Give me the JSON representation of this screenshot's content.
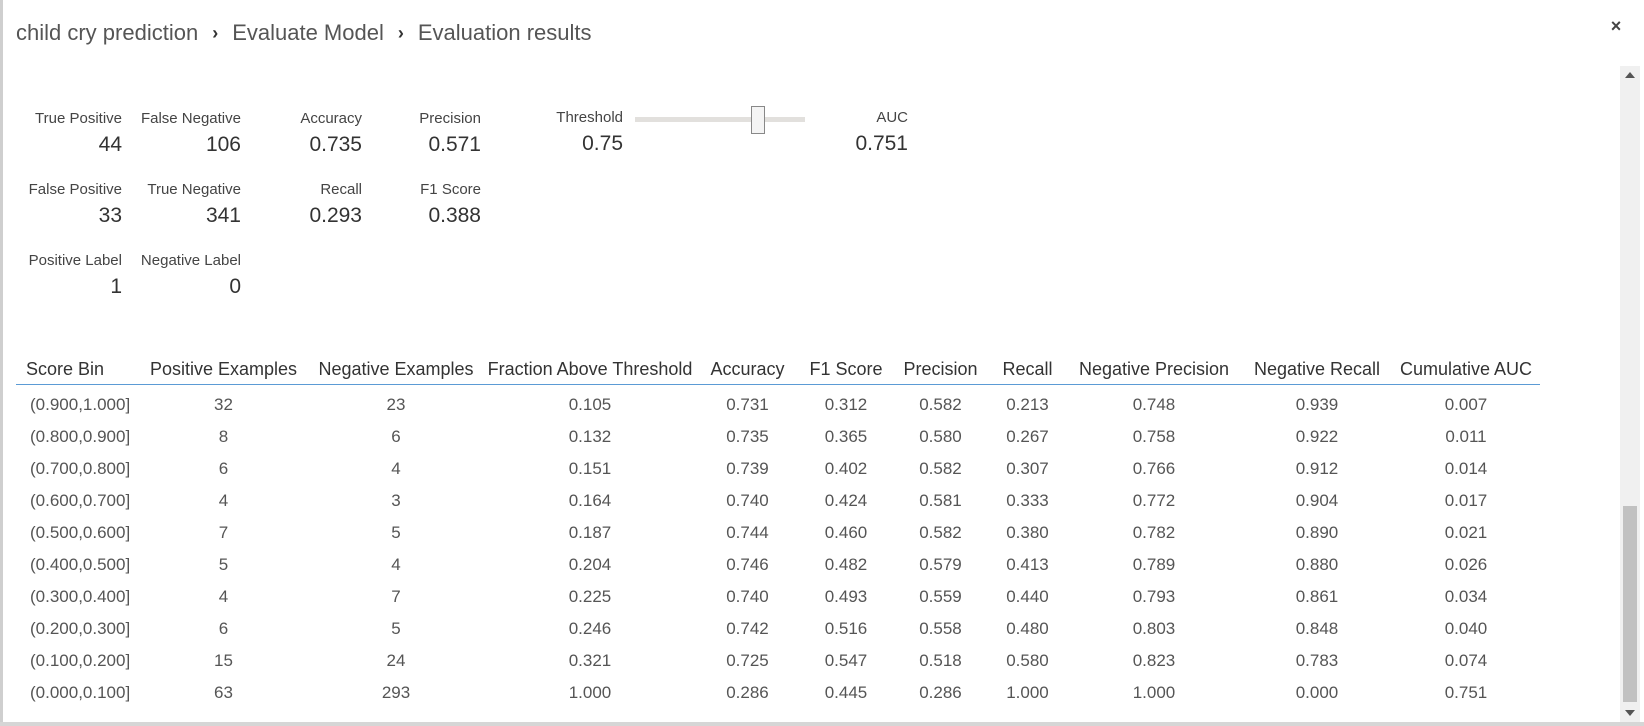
{
  "breadcrumb": {
    "items": [
      "child cry prediction",
      "Evaluate Model",
      "Evaluation results"
    ],
    "separator": "›"
  },
  "close_label": "×",
  "metrics": {
    "true_positive": {
      "label": "True Positive",
      "value": "44"
    },
    "false_negative": {
      "label": "False Negative",
      "value": "106"
    },
    "false_positive": {
      "label": "False Positive",
      "value": "33"
    },
    "true_negative": {
      "label": "True Negative",
      "value": "341"
    },
    "positive_label": {
      "label": "Positive Label",
      "value": "1"
    },
    "negative_label": {
      "label": "Negative Label",
      "value": "0"
    },
    "accuracy": {
      "label": "Accuracy",
      "value": "0.735"
    },
    "precision": {
      "label": "Precision",
      "value": "0.571"
    },
    "recall": {
      "label": "Recall",
      "value": "0.293"
    },
    "f1_score": {
      "label": "F1 Score",
      "value": "0.388"
    },
    "threshold": {
      "label": "Threshold",
      "value": "0.75"
    },
    "auc": {
      "label": "AUC",
      "value": "0.751"
    }
  },
  "threshold_slider": {
    "value": 0.75
  },
  "table": {
    "headers": [
      "Score Bin",
      "Positive Examples",
      "Negative Examples",
      "Fraction Above Threshold",
      "Accuracy",
      "F1 Score",
      "Precision",
      "Recall",
      "Negative Precision",
      "Negative Recall",
      "Cumulative AUC"
    ],
    "rows": [
      [
        "(0.900,1.000]",
        "32",
        "23",
        "0.105",
        "0.731",
        "0.312",
        "0.582",
        "0.213",
        "0.748",
        "0.939",
        "0.007"
      ],
      [
        "(0.800,0.900]",
        "8",
        "6",
        "0.132",
        "0.735",
        "0.365",
        "0.580",
        "0.267",
        "0.758",
        "0.922",
        "0.011"
      ],
      [
        "(0.700,0.800]",
        "6",
        "4",
        "0.151",
        "0.739",
        "0.402",
        "0.582",
        "0.307",
        "0.766",
        "0.912",
        "0.014"
      ],
      [
        "(0.600,0.700]",
        "4",
        "3",
        "0.164",
        "0.740",
        "0.424",
        "0.581",
        "0.333",
        "0.772",
        "0.904",
        "0.017"
      ],
      [
        "(0.500,0.600]",
        "7",
        "5",
        "0.187",
        "0.744",
        "0.460",
        "0.582",
        "0.380",
        "0.782",
        "0.890",
        "0.021"
      ],
      [
        "(0.400,0.500]",
        "5",
        "4",
        "0.204",
        "0.746",
        "0.482",
        "0.579",
        "0.413",
        "0.789",
        "0.880",
        "0.026"
      ],
      [
        "(0.300,0.400]",
        "4",
        "7",
        "0.225",
        "0.740",
        "0.493",
        "0.559",
        "0.440",
        "0.793",
        "0.861",
        "0.034"
      ],
      [
        "(0.200,0.300]",
        "6",
        "5",
        "0.246",
        "0.742",
        "0.516",
        "0.558",
        "0.480",
        "0.803",
        "0.848",
        "0.040"
      ],
      [
        "(0.100,0.200]",
        "15",
        "24",
        "0.321",
        "0.725",
        "0.547",
        "0.518",
        "0.580",
        "0.823",
        "0.783",
        "0.074"
      ],
      [
        "(0.000,0.100]",
        "63",
        "293",
        "1.000",
        "0.286",
        "0.445",
        "0.286",
        "1.000",
        "1.000",
        "0.000",
        "0.751"
      ]
    ]
  },
  "colors": {
    "header_rule": "#5b9bd5",
    "text": "#333333",
    "muted_text": "#555555"
  }
}
